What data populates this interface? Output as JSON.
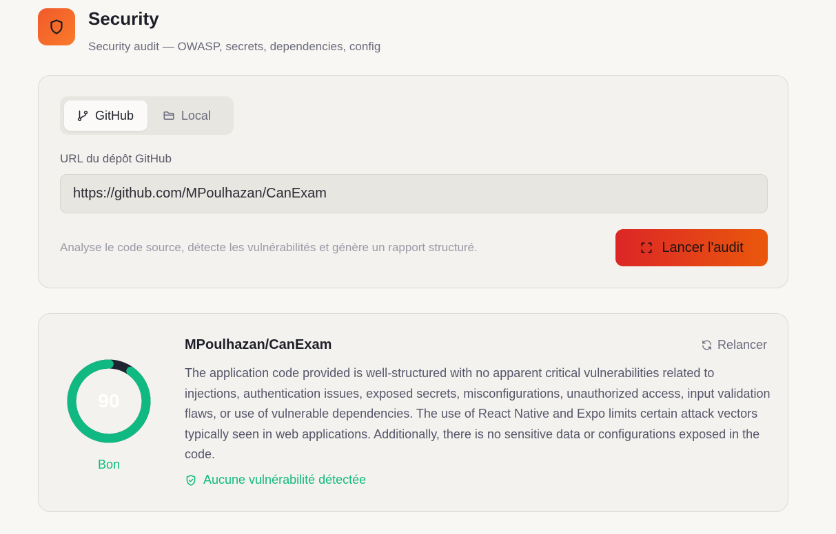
{
  "header": {
    "title": "Security",
    "subtitle": "Security audit — OWASP, secrets, dependencies, config",
    "icon": "shield-icon",
    "accent": "#f15a2b"
  },
  "source_toggle": {
    "github_label": "GitHub",
    "local_label": "Local",
    "selected": "GitHub"
  },
  "repo_field": {
    "label": "URL du dépôt GitHub",
    "value": "https://github.com/MPoulhazan/CanExam"
  },
  "hint": "Analyse le code source, détecte les vulnérabilités et génère un rapport structuré.",
  "run_button": {
    "label": "Lancer l'audit",
    "icon": "scan-icon"
  },
  "result": {
    "score": "90",
    "score_fraction": 0.9,
    "grade": "Bon",
    "repo": "MPoulhazan/CanExam",
    "rerun_label": "Relancer",
    "summary": "The application code provided is well-structured with no apparent critical vulnerabilities related to injections, authentication issues, exposed secrets, misconfigurations, unauthorized access, input validation flaws, or use of vulnerable dependencies. The use of React Native and Expo limits certain attack vectors typically seen in web applications. Additionally, there is no sensitive data or configurations exposed in the code.",
    "status": "Aucune vulnérabilité détectée",
    "good_color": "#10b981",
    "track_color": "#1f2430"
  }
}
